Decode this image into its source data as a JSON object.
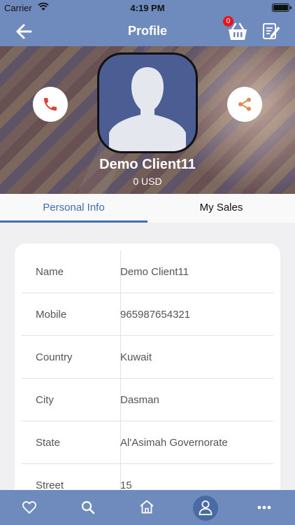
{
  "status_bar": {
    "carrier": "Carrier",
    "time": "4:19 PM"
  },
  "nav": {
    "title": "Profile",
    "cart_count": "0",
    "icons": [
      "back-arrow-icon",
      "basket-icon",
      "edit-note-icon"
    ]
  },
  "profile": {
    "name": "Demo Client11",
    "balance": "0 USD",
    "icons": [
      "phone-icon",
      "share-icon",
      "avatar-placeholder-icon"
    ]
  },
  "tabs": [
    {
      "label": "Personal Info",
      "active": true
    },
    {
      "label": "My Sales",
      "active": false
    }
  ],
  "info_rows": [
    {
      "label": "Name",
      "value": "Demo Client11"
    },
    {
      "label": "Mobile",
      "value": "965987654321"
    },
    {
      "label": "Country",
      "value": "Kuwait"
    },
    {
      "label": "City",
      "value": "Dasman"
    },
    {
      "label": "State",
      "value": "Al'Asimah Governorate"
    },
    {
      "label": "Street",
      "value": "15"
    }
  ],
  "tab_bar": {
    "items": [
      "heart-icon",
      "search-icon",
      "home-icon",
      "user-icon",
      "more-icon"
    ],
    "active": "user-icon"
  },
  "colors": {
    "primary": "#6f8bbd",
    "active_tab": "#3f6fb0",
    "badge": "#e8141c",
    "call_icon": "#d9433a",
    "share_icon": "#e08a55"
  }
}
